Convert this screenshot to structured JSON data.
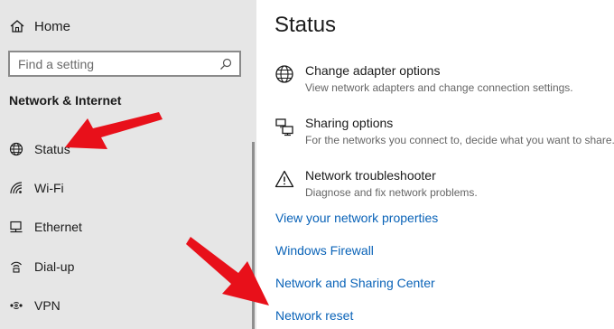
{
  "sidebar": {
    "home_label": "Home",
    "search_placeholder": "Find a setting",
    "section_title": "Network & Internet",
    "items": [
      {
        "label": "Status",
        "icon": "globe-icon"
      },
      {
        "label": "Wi-Fi",
        "icon": "wifi-icon"
      },
      {
        "label": "Ethernet",
        "icon": "ethernet-icon"
      },
      {
        "label": "Dial-up",
        "icon": "dialup-icon"
      },
      {
        "label": "VPN",
        "icon": "vpn-icon"
      }
    ]
  },
  "main": {
    "title": "Status",
    "options": [
      {
        "title": "Change adapter options",
        "desc": "View network adapters and change connection settings.",
        "icon": "globe-icon"
      },
      {
        "title": "Sharing options",
        "desc": "For the networks you connect to, decide what you want to share.",
        "icon": "sharing-icon"
      },
      {
        "title": "Network troubleshooter",
        "desc": "Diagnose and fix network problems.",
        "icon": "warning-icon"
      }
    ],
    "links": [
      "View your network properties",
      "Windows Firewall",
      "Network and Sharing Center",
      "Network reset"
    ]
  },
  "colors": {
    "sidebar_bg": "#e6e6e6",
    "link": "#0a63b8",
    "annotation_arrow": "#e8101a"
  }
}
